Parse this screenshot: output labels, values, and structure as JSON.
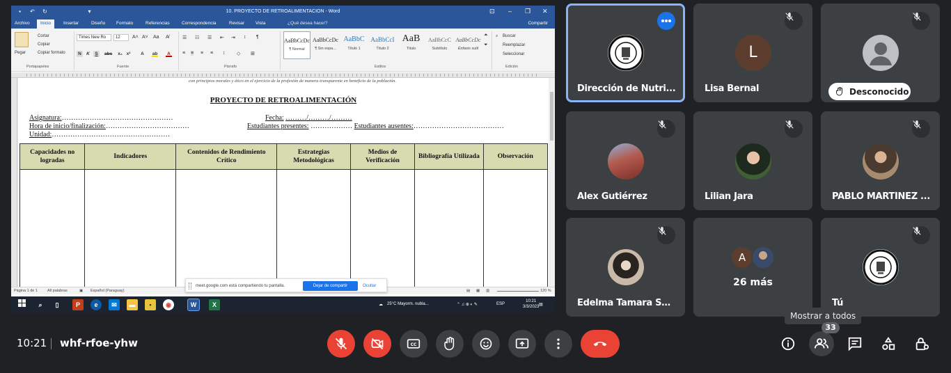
{
  "shared_screen": {
    "word": {
      "window_title": "10. PROYECTO DE RETROALIMENTACION  -  Word",
      "tabs": [
        "Archivo",
        "Inicio",
        "Insertar",
        "Diseño",
        "Formato",
        "Referencias",
        "Correspondencia",
        "Revisar",
        "Vista"
      ],
      "active_tab": "Inicio",
      "tell_me": "¿Qué desea hacer?",
      "share": "Compartir",
      "clipboard": {
        "paste": "Pegar",
        "cut": "Cortar",
        "copy": "Copiar",
        "format_painter": "Copiar formato"
      },
      "font_name": "Times New Ro",
      "font_size": "12",
      "styles": [
        {
          "preview": "AaBbCcDc",
          "label": "¶ Normal"
        },
        {
          "preview": "AaBbCcDc",
          "label": "¶ Sin espa..."
        },
        {
          "preview": "AaBbC",
          "label": "Título 1"
        },
        {
          "preview": "AaBbCcI",
          "label": "Título 2"
        },
        {
          "preview": "AaB",
          "label": "Título"
        },
        {
          "preview": "AaBbCcC",
          "label": "Subtítulo"
        },
        {
          "preview": "AaBbCcDc",
          "label": "Énfasis sutil"
        }
      ],
      "editing": {
        "find": "Buscar",
        "replace": "Reemplazar",
        "select": "Seleccionar"
      },
      "group_labels": [
        "Portapapeles",
        "Fuente",
        "Párrafo",
        "Estilos",
        "Edición"
      ],
      "document": {
        "cut_line": "con principios morales y ético en el ejercicio de la profesión de manera transparente en beneficio de la población.",
        "heading": "PROYECTO DE RETROALIMENTACIÓN",
        "fields": {
          "asignatura_label": "Asignatura:",
          "asignatura_dots": "…………………………………………",
          "fecha_label": "Fecha:",
          "fecha_value": "………/………/………",
          "hora_label": "Hora de inicio/finalización:",
          "hora_dots": "………………………………",
          "presentes_label": "Estudiantes presentes:",
          "presentes_dots": "………………",
          "ausentes_label": "Estudiantes ausentes:",
          "ausentes_dots": "…………………………………",
          "unidad_label": "Unidad:",
          "unidad_dots": "……………………………………………"
        },
        "table_headers": [
          "Capacidades no logradas",
          "Indicadores",
          "Contenidos de Rendimiento Crítico",
          "Estrategias Metodológicas",
          "Medios de Verificación",
          "Bibliografía Utilizada",
          "Observación"
        ]
      },
      "status": {
        "page": "Página 1 de 1",
        "words": "All palabras",
        "language": "Español (Paraguay)",
        "zoom": "120 %"
      }
    },
    "share_banner": {
      "message": "meet.google.com está compartiendo tu pantalla.",
      "stop": "Dejar de compartir",
      "hide": "Ocultar"
    },
    "taskbar": {
      "weather": "25°C  Mayorm. nubla...",
      "lang": "ESP",
      "time": "10:21",
      "date": "3/3/2023"
    }
  },
  "participants": [
    {
      "name": "Dirección de Nutri...",
      "type": "seal",
      "muted": false,
      "active": true
    },
    {
      "name": "Lisa Bernal",
      "type": "letter",
      "letter": "L",
      "muted": true
    },
    {
      "name": "Desconocido",
      "type": "unknown",
      "muted": true
    },
    {
      "name": "Alex Gutiérrez",
      "type": "photo",
      "muted": true
    },
    {
      "name": "Lilian Jara",
      "type": "photo",
      "muted": true
    },
    {
      "name": "PABLO MARTÍNEZ ...",
      "type": "photo",
      "muted": true
    },
    {
      "name": "Edelma Tamara Sal...",
      "type": "photo",
      "muted": true
    },
    {
      "name": "26 más",
      "type": "overflow",
      "letter": "A",
      "muted": false
    },
    {
      "name": "Tú",
      "type": "seal",
      "muted": true
    }
  ],
  "bottom_bar": {
    "time": "10:21",
    "meeting_code": "whf-rfoe-yhw",
    "tooltip": "Mostrar a todos",
    "participant_count": "33"
  },
  "colors": {
    "accent_blue": "#1a73e8",
    "danger_red": "#ea4335",
    "word_blue": "#2b579a",
    "table_header": "#d7dcb0"
  }
}
